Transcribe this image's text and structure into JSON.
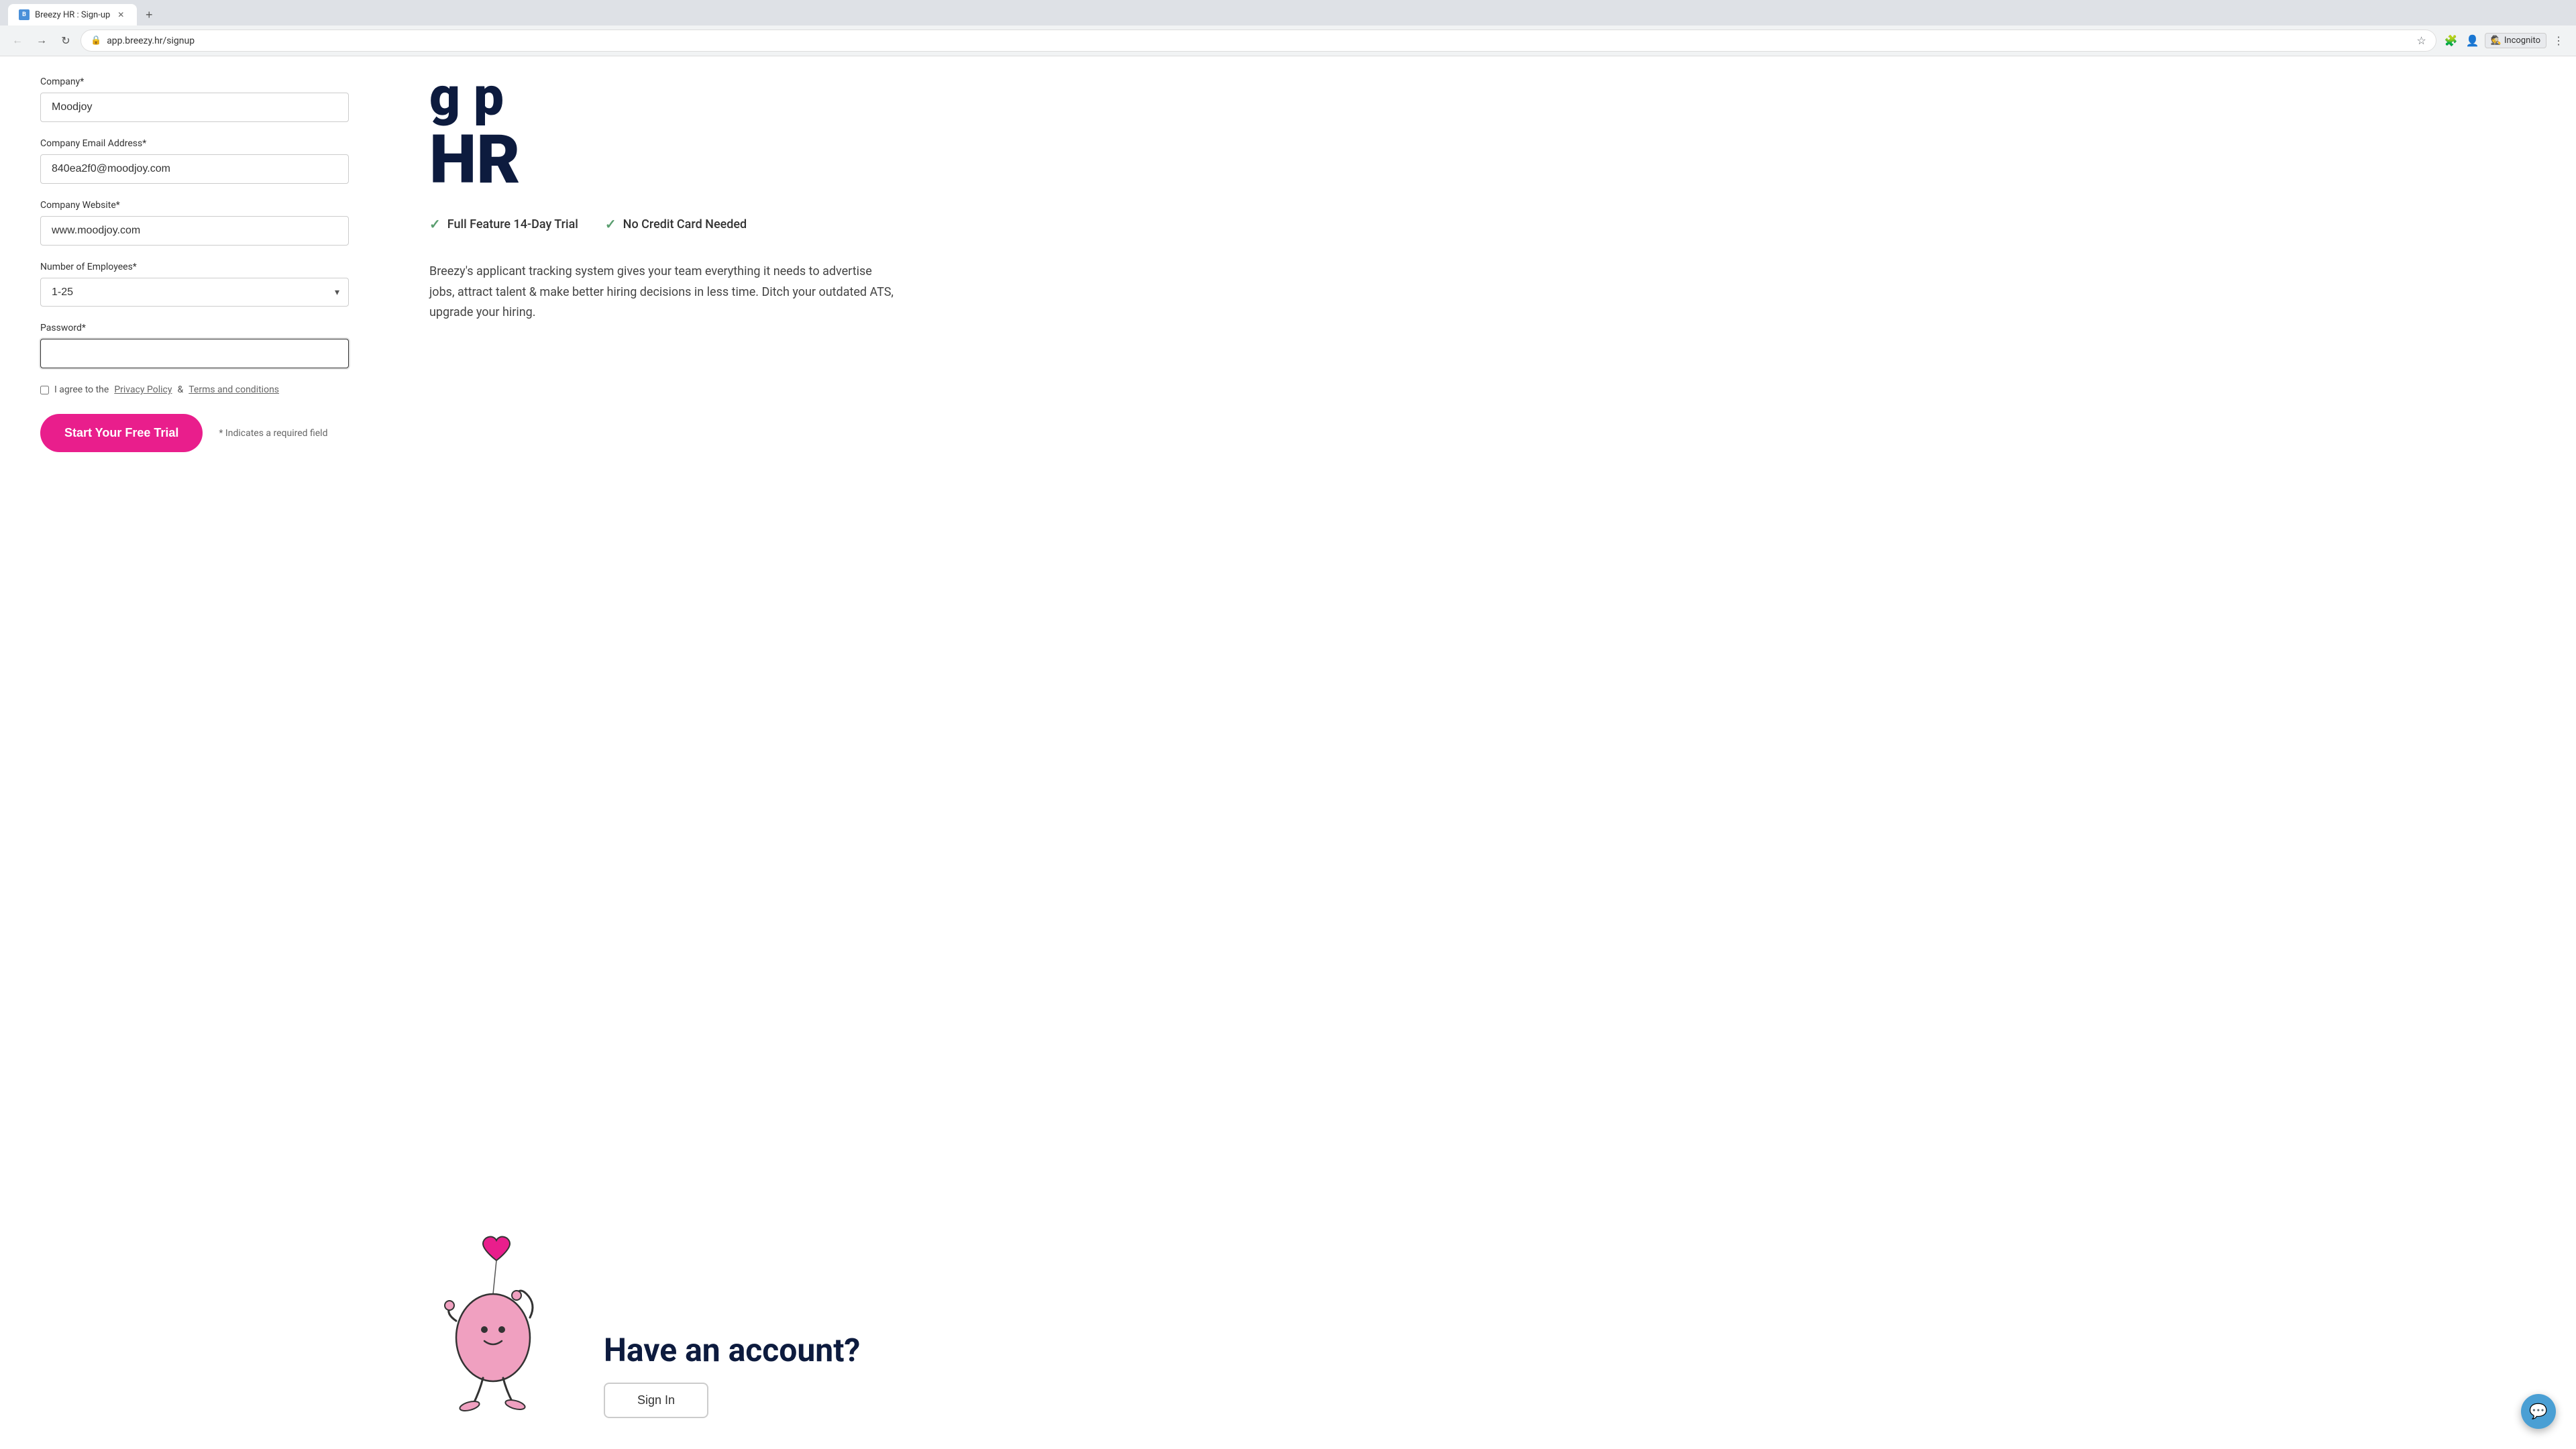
{
  "browser": {
    "tab_title": "Breezy HR : Sign-up",
    "tab_favicon": "B",
    "address_url": "app.breezy.hr/signup",
    "incognito_label": "Incognito"
  },
  "form": {
    "company_label": "Company*",
    "company_value": "Moodjoy",
    "email_label": "Company Email Address*",
    "email_value": "840ea2f0@moodjoy.com",
    "website_label": "Company Website*",
    "website_value": "www.moodjoy.com",
    "employees_label": "Number of Employees*",
    "employees_value": "1-25",
    "password_label": "Password*",
    "password_value": "",
    "password_placeholder": "",
    "agree_text": "I agree to the",
    "privacy_policy": "Privacy Policy",
    "and_text": "&",
    "terms": "Terms and conditions",
    "cta_button": "Start Your Free Trial",
    "required_note": "* Indicates a required field"
  },
  "right_panel": {
    "headline_line1": "g p",
    "headline_line2": "HR",
    "feature1": "Full Feature 14-Day Trial",
    "feature2": "No Credit Card Needed",
    "description": "Breezy's applicant tracking system gives your team everything it needs to advertise jobs, attract talent & make better hiring decisions in less time. Ditch your outdated ATS, upgrade your hiring.",
    "have_account_title": "Have an account?",
    "sign_in_label": "Sign In"
  }
}
